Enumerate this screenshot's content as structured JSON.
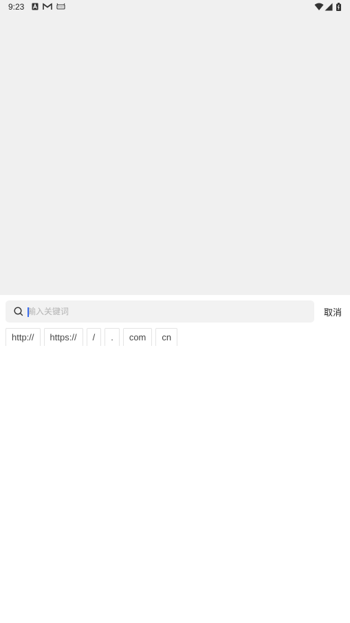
{
  "status_bar": {
    "time": "9:23",
    "left_icons": [
      "notification-a-icon",
      "gmail-icon",
      "android-bot-icon"
    ],
    "right_icons": [
      "wifi-icon",
      "signal-icon",
      "battery-icon"
    ]
  },
  "search": {
    "placeholder": "輸入关键词",
    "value": "",
    "icon": "search-icon"
  },
  "actions": {
    "cancel_label": "取消"
  },
  "quick_chips": [
    {
      "label": "http://"
    },
    {
      "label": "https://"
    },
    {
      "label": "/"
    },
    {
      "label": "."
    },
    {
      "label": "com"
    },
    {
      "label": "cn"
    }
  ],
  "colors": {
    "top_background": "#f0f0f0",
    "sheet_background": "#ffffff",
    "search_background": "#f2f2f2",
    "caret": "#3a6df0"
  }
}
